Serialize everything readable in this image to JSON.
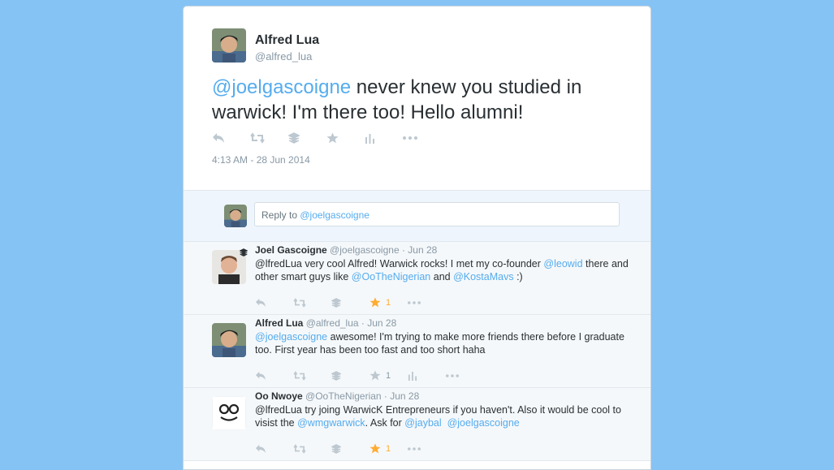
{
  "tweet": {
    "author_name": "Alfred Lua",
    "author_handle": "@alfred_lua",
    "text_mention": "@joelgascoigne",
    "text_body": " never knew you studied in warwick! I'm there too! Hello alumni!",
    "timestamp": "4:13 AM - 28 Jun 2014"
  },
  "reply_box": {
    "prefix": "Reply to ",
    "mention": "@joelgascoigne"
  },
  "replies": [
    {
      "name": "Joel Gascoigne",
      "meta": "@joelgascoigne · Jun 28",
      "t1": "@lfredLua very cool Alfred! Warwick rocks! I met my co-founder ",
      "m1": "@leowid",
      "t2": " there and other smart guys like ",
      "m2": "@OoTheNigerian",
      "t3": " and ",
      "m3": "@KostaMavs",
      "t4": " :)",
      "fav_count": "1"
    },
    {
      "name": "Alfred Lua",
      "meta": "@alfred_lua · Jun 28",
      "m1": "@joelgascoigne",
      "t1": " awesome! I'm trying to make more friends there before I graduate too. First year has been too fast and too short haha",
      "fav_count": "1"
    },
    {
      "name": "Oo Nwoye",
      "meta": "@OoTheNigerian · Jun 28",
      "t1": "@lfredLua try joing WarwicK Entrepreneurs if you haven't. Also it would be cool to visist the ",
      "m1": "@wmgwarwick",
      "t2": ". Ask for ",
      "m2": "@jaybal",
      "t3": "  ",
      "m3": "@joelgascoigne",
      "fav_count": "1"
    }
  ],
  "icons": [
    "reply-icon",
    "retweet-icon",
    "buffer-icon",
    "favorite-icon",
    "analytics-icon",
    "more-icon"
  ],
  "colors": {
    "background": "#86c3f5",
    "link": "#55acee",
    "favorite": "#ffac33"
  }
}
